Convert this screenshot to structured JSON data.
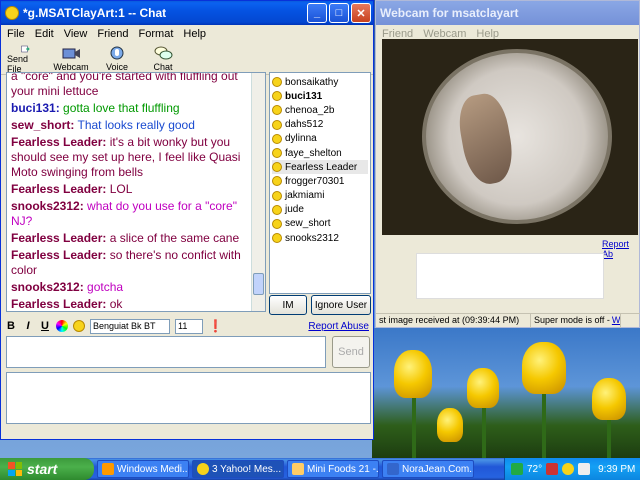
{
  "chat_window": {
    "title": "*g.MSATClayArt:1 -- Chat",
    "menu": [
      "File",
      "Edit",
      "View",
      "Friend",
      "Format",
      "Help"
    ],
    "toolbar": [
      {
        "label": "Send File",
        "icon": "send-file-icon"
      },
      {
        "label": "Webcam",
        "icon": "webcam-icon"
      },
      {
        "label": "Voice",
        "icon": "voice-icon"
      },
      {
        "label": "Chat",
        "icon": "chat-icon"
      }
    ],
    "messages": [
      {
        "user": "",
        "text": "a \"core\" and you're started with fluffling out your mini lettuce",
        "color": "#800040",
        "partial": true
      },
      {
        "user": "buci131:",
        "text": "gotta love that fluffling",
        "color": "#009900",
        "ucolor": "#1a1ab0"
      },
      {
        "user": "sew_short:",
        "text": "That looks really good",
        "color": "#1a4bd0",
        "ucolor": "#800040"
      },
      {
        "user": "Fearless Leader:",
        "text": "it's a bit wonky but you should see my set up here, I feel like Quasi Moto swinging from bells",
        "color": "#800040",
        "ucolor": "#800040"
      },
      {
        "user": "Fearless Leader:",
        "text": "LOL",
        "color": "#800040",
        "ucolor": "#800040"
      },
      {
        "user": "snooks2312:",
        "text": "what do you use for a \"core\" NJ?",
        "color": "#c000c0",
        "ucolor": "#800040"
      },
      {
        "user": "Fearless Leader:",
        "text": "a slice of the same cane",
        "color": "#800040",
        "ucolor": "#800040"
      },
      {
        "user": "Fearless Leader:",
        "text": "so there's no confict with color",
        "color": "#800040",
        "ucolor": "#800040"
      },
      {
        "user": "snooks2312:",
        "text": "gotcha",
        "color": "#c000c0",
        "ucolor": "#800040"
      },
      {
        "user": "Fearless Leader:",
        "text": "ok",
        "color": "#800040",
        "ucolor": "#800040"
      }
    ],
    "buddies": [
      "bonsaikathy",
      "buci131",
      "chenoa_2b",
      "dahs512",
      "dylinna",
      "faye_shelton",
      "Fearless Leader",
      "frogger70301",
      "jakmiami",
      "jude",
      "sew_short",
      "snooks2312"
    ],
    "selected_buddy": "Fearless Leader",
    "bold_buddy": "buci131",
    "im_label": "IM",
    "ignore_label": "Ignore User",
    "font_name": "Benguiat Bk BT",
    "font_size": "11",
    "report_abuse": "Report Abuse",
    "send_label": "Send"
  },
  "webcam_window": {
    "title": "Webcam for msatclayart",
    "menu": [
      "Friend",
      "Webcam",
      "Help"
    ],
    "report_link": "Report Ab",
    "status_received": "st image received at (09:39:44 PM)",
    "status_super": "Super mode is off -",
    "status_link": "What's th"
  },
  "taskbar": {
    "start_label": "start",
    "tasks": [
      "Windows Medi...",
      "3 Yahoo! Mes...",
      "Mini Foods 21 -...",
      "NoraJean.Com..."
    ],
    "clock": "9:39 PM",
    "tray_temp": "72°"
  },
  "colors": {
    "xp_blue": "#0553e2",
    "chat_red": "#800040"
  }
}
